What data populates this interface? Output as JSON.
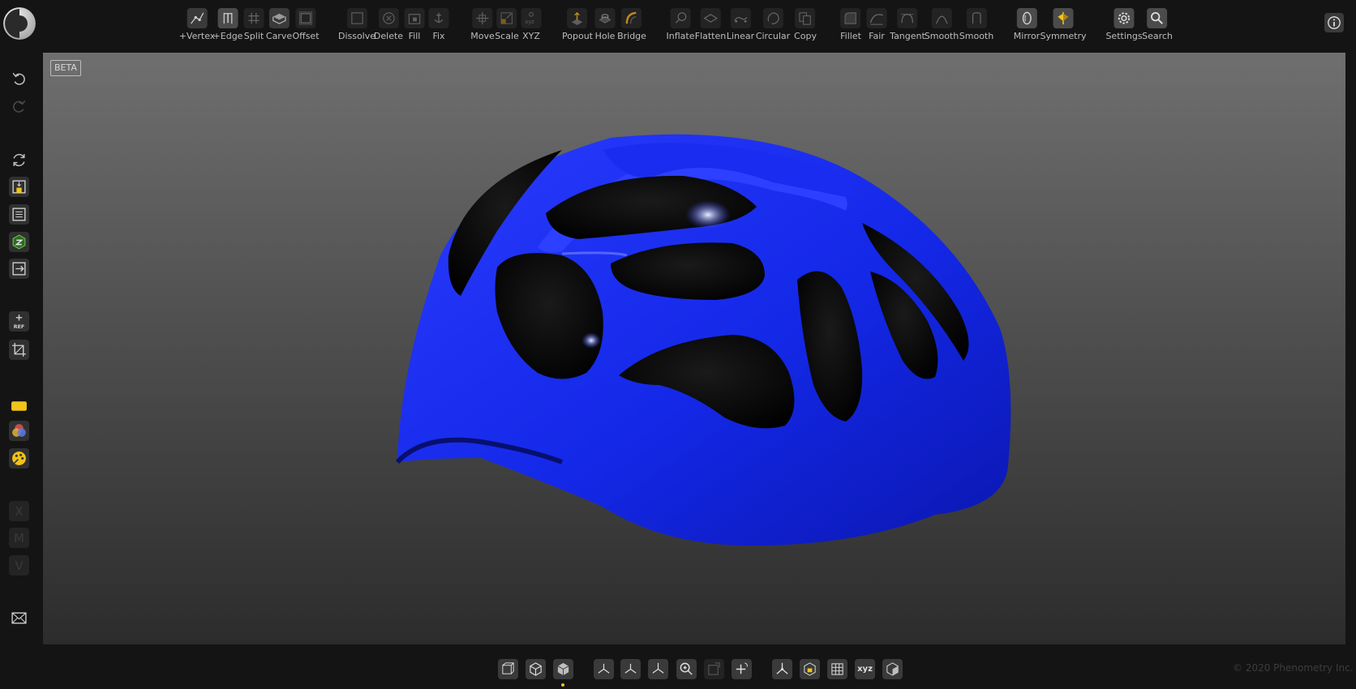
{
  "toolbar": {
    "tools": [
      {
        "id": "vertex",
        "label": "+Vertex",
        "icon": "add-vertex-icon"
      },
      {
        "id": "edge",
        "label": "+Edge",
        "icon": "add-edge-icon"
      },
      {
        "id": "split",
        "label": "Split",
        "icon": "split-icon"
      },
      {
        "id": "carve",
        "label": "Carve",
        "icon": "carve-icon"
      },
      {
        "id": "offset",
        "label": "Offset",
        "icon": "offset-icon"
      },
      {
        "id": "dissolve",
        "label": "Dissolve",
        "icon": "dissolve-icon"
      },
      {
        "id": "delete",
        "label": "Delete",
        "icon": "delete-icon"
      },
      {
        "id": "fill",
        "label": "Fill",
        "icon": "fill-icon"
      },
      {
        "id": "fix",
        "label": "Fix",
        "icon": "fix-icon"
      },
      {
        "id": "move",
        "label": "Move",
        "icon": "move-icon"
      },
      {
        "id": "scale",
        "label": "Scale",
        "icon": "scale-icon"
      },
      {
        "id": "xyz",
        "label": "XYZ",
        "icon": "xyz-icon"
      },
      {
        "id": "popout",
        "label": "Popout",
        "icon": "popout-icon"
      },
      {
        "id": "hole",
        "label": "Hole",
        "icon": "hole-icon"
      },
      {
        "id": "bridge",
        "label": "Bridge",
        "icon": "bridge-icon"
      },
      {
        "id": "inflate",
        "label": "Inflate",
        "icon": "inflate-icon"
      },
      {
        "id": "flatten",
        "label": "Flatten",
        "icon": "flatten-icon"
      },
      {
        "id": "linear",
        "label": "Linear",
        "icon": "linear-icon"
      },
      {
        "id": "circular",
        "label": "Circular",
        "icon": "circular-icon"
      },
      {
        "id": "copy",
        "label": "Copy",
        "icon": "copy-icon"
      },
      {
        "id": "fillet",
        "label": "Fillet",
        "icon": "fillet-icon"
      },
      {
        "id": "fair",
        "label": "Fair",
        "icon": "fair-icon"
      },
      {
        "id": "tangent",
        "label": "Tangent",
        "icon": "tangent-icon"
      },
      {
        "id": "smooth1",
        "label": "Smooth",
        "icon": "smooth-curve-icon"
      },
      {
        "id": "smooth2",
        "label": "Smooth",
        "icon": "smooth-surface-icon"
      },
      {
        "id": "mirror",
        "label": "Mirror",
        "icon": "mirror-icon"
      },
      {
        "id": "symmetry",
        "label": "Symmetry",
        "icon": "symmetry-icon"
      },
      {
        "id": "settings",
        "label": "Settings",
        "icon": "gear-icon"
      },
      {
        "id": "search",
        "label": "Search",
        "icon": "search-icon"
      }
    ]
  },
  "sidebar": {
    "buttons": [
      {
        "id": "undo",
        "icon": "undo-icon"
      },
      {
        "id": "redo",
        "icon": "redo-icon"
      },
      {
        "id": "refresh",
        "icon": "refresh-icon"
      },
      {
        "id": "save",
        "icon": "save-icon"
      },
      {
        "id": "save-as",
        "icon": "save-as-icon"
      },
      {
        "id": "export-3d",
        "icon": "export-3d-icon"
      },
      {
        "id": "export",
        "icon": "export-icon"
      },
      {
        "id": "add-ref",
        "icon": "add-reference-icon",
        "label": "REF"
      },
      {
        "id": "crop",
        "icon": "crop-icon"
      },
      {
        "id": "material",
        "icon": "material-icon"
      },
      {
        "id": "color",
        "icon": "color-wheel-icon"
      },
      {
        "id": "palette",
        "icon": "palette-icon"
      },
      {
        "id": "x-axis",
        "icon": "x-letter-icon",
        "label": "X"
      },
      {
        "id": "m-key",
        "icon": "m-letter-icon",
        "label": "M"
      },
      {
        "id": "v-key",
        "icon": "v-letter-icon",
        "label": "V"
      },
      {
        "id": "mail",
        "icon": "mail-icon"
      }
    ]
  },
  "viewport": {
    "beta_label": "BETA",
    "model_color": "#1a2fff"
  },
  "bottombar": {
    "buttons": [
      {
        "id": "wireframe",
        "icon": "wireframe-cube-icon"
      },
      {
        "id": "outline",
        "icon": "outline-cube-icon"
      },
      {
        "id": "solid",
        "icon": "solid-cube-icon"
      },
      {
        "id": "view-x",
        "icon": "axis-x-view-icon"
      },
      {
        "id": "view-y",
        "icon": "axis-y-view-icon"
      },
      {
        "id": "view-z",
        "icon": "axis-z-view-icon"
      },
      {
        "id": "zoom",
        "icon": "zoom-icon"
      },
      {
        "id": "frame",
        "icon": "frame-select-icon"
      },
      {
        "id": "pivot",
        "icon": "pivot-icon"
      },
      {
        "id": "gizmo",
        "icon": "gizmo-icon"
      },
      {
        "id": "box",
        "icon": "bounding-box-icon"
      },
      {
        "id": "grid",
        "icon": "grid-icon"
      },
      {
        "id": "xyz",
        "icon": "xyz-label-icon",
        "label": "xyz"
      },
      {
        "id": "ortho",
        "icon": "ortho-cube-icon"
      }
    ]
  },
  "footer": {
    "copyright": "© 2020 Phenometry Inc."
  },
  "colors": {
    "accent": "#f2c318",
    "background": "#141414",
    "button": "#3a3a3a"
  }
}
